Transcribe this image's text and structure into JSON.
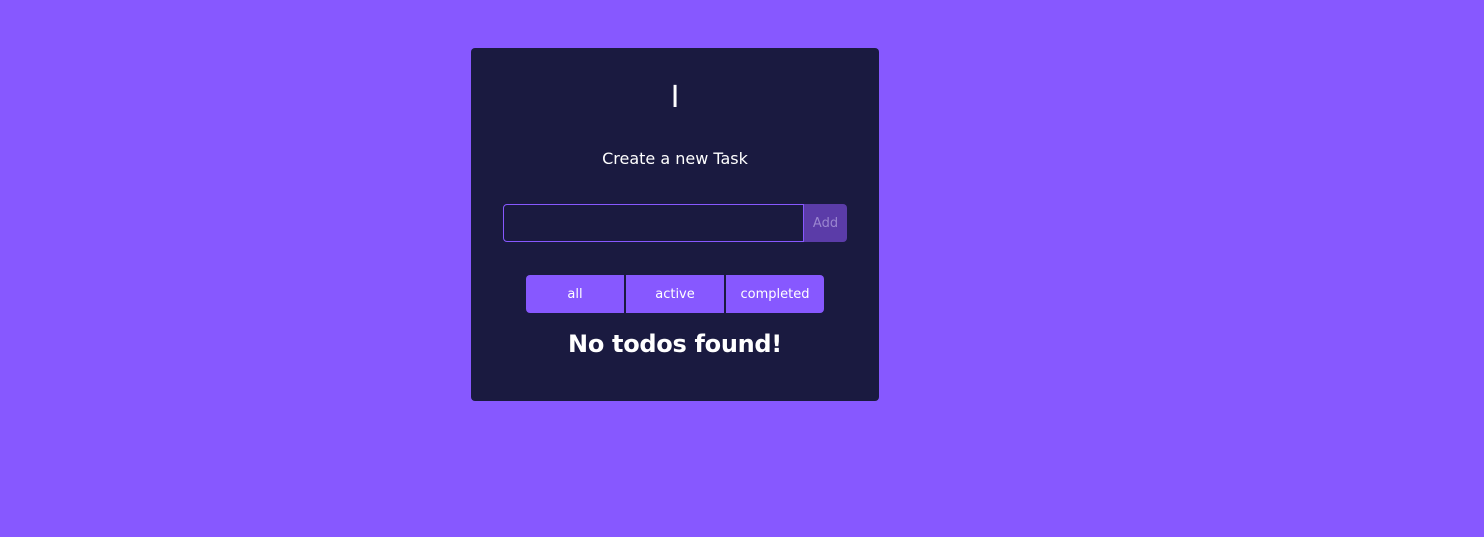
{
  "theme": {
    "background": "#8758ff",
    "card_background": "#1a1a40",
    "accent": "#8758ff",
    "add_button_background": "#5b3ca8",
    "text": "#ffffff"
  },
  "card": {
    "title": "I",
    "subtitle": "Create a new Task"
  },
  "form": {
    "input_value": "",
    "input_placeholder": "",
    "add_label": "Add"
  },
  "filters": [
    {
      "label": "all"
    },
    {
      "label": "active"
    },
    {
      "label": "completed"
    }
  ],
  "empty_state": {
    "message": "No todos found!"
  }
}
